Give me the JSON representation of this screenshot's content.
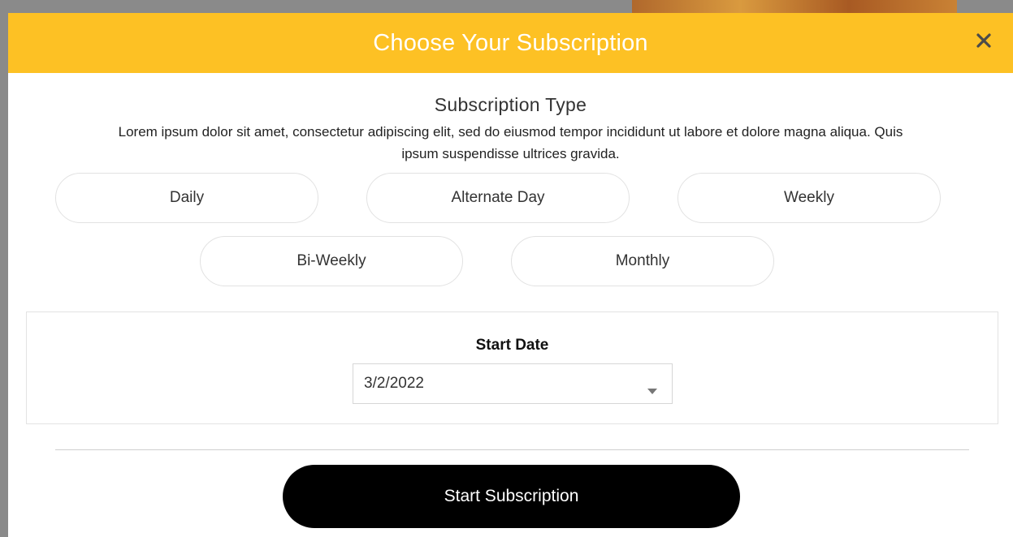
{
  "modal": {
    "title": "Choose Your Subscription",
    "close_icon": "close-icon"
  },
  "subscription": {
    "heading": "Subscription Type",
    "description": "Lorem ipsum dolor sit amet, consectetur adipiscing elit, sed do eiusmod tempor incididunt ut labore et dolore magna aliqua. Quis ipsum suspendisse ultrices gravida.",
    "options": [
      "Daily",
      "Alternate Day",
      "Weekly",
      "Bi-Weekly",
      "Monthly"
    ]
  },
  "start_date": {
    "label": "Start Date",
    "value": "3/2/2022",
    "dropdown_icon": "chevron-down-icon"
  },
  "actions": {
    "start_label": "Start Subscription"
  },
  "colors": {
    "header_bg": "#fdc124",
    "button_bg": "#000000"
  }
}
